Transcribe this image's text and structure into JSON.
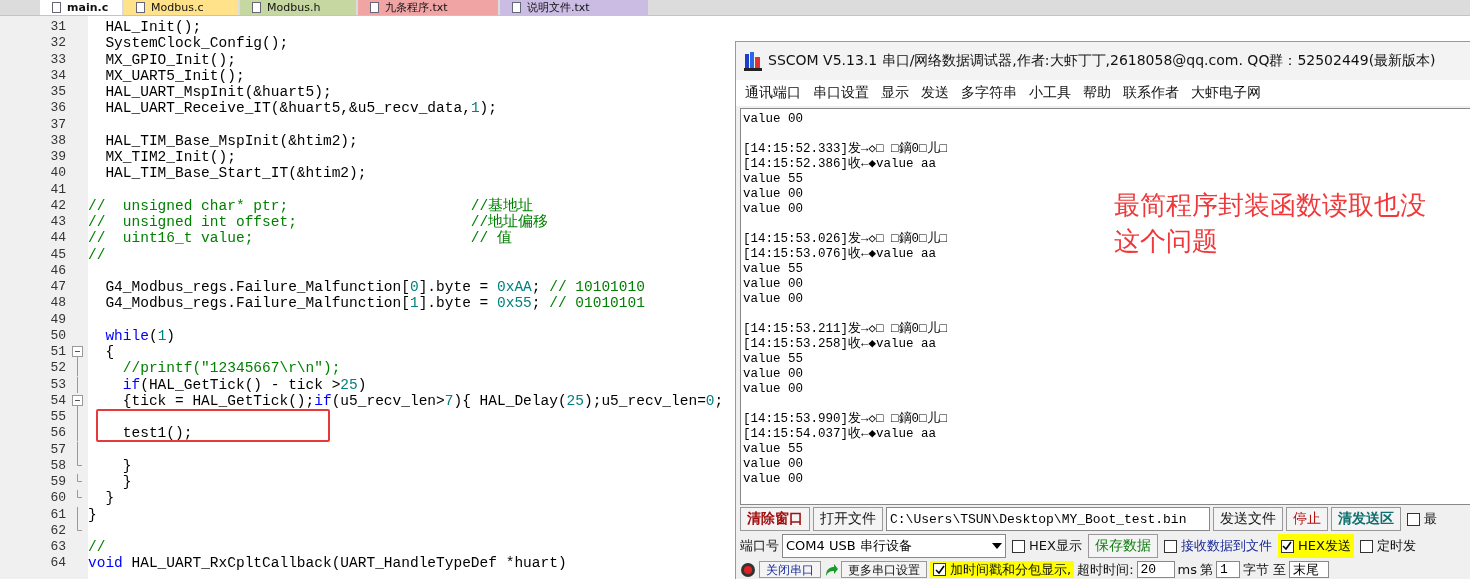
{
  "editor": {
    "tabs": [
      {
        "label": "main.c",
        "selected": true,
        "color": "#ffffff"
      },
      {
        "label": "Modbus.c",
        "selected": false,
        "color": "#ffe28a"
      },
      {
        "label": "Modbus.h",
        "selected": false,
        "color": "#c6d7a2"
      },
      {
        "label": "九条程序.txt",
        "selected": false,
        "color": "#f1a4a4"
      },
      {
        "label": "说明文件.txt",
        "selected": false,
        "color": "#cbbce3"
      }
    ],
    "lines": [
      {
        "number": "31",
        "segments": [
          {
            "kind": "plain",
            "text": "  HAL_Init();"
          }
        ]
      },
      {
        "number": "32",
        "segments": [
          {
            "kind": "plain",
            "text": "  SystemClock_Config();"
          }
        ]
      },
      {
        "number": "33",
        "segments": [
          {
            "kind": "plain",
            "text": "  MX_GPIO_Init();"
          }
        ]
      },
      {
        "number": "34",
        "segments": [
          {
            "kind": "plain",
            "text": "  MX_UART5_Init();"
          }
        ]
      },
      {
        "number": "35",
        "segments": [
          {
            "kind": "plain",
            "text": "  HAL_UART_MspInit(&huart5);"
          }
        ]
      },
      {
        "number": "36",
        "segments": [
          {
            "kind": "plain",
            "text": "  HAL_UART_Receive_IT(&huart5,&u5_recv_data,"
          },
          {
            "kind": "num",
            "text": "1"
          },
          {
            "kind": "plain",
            "text": ");"
          }
        ]
      },
      {
        "number": "37"
      },
      {
        "number": "38",
        "segments": [
          {
            "kind": "plain",
            "text": "  HAL_TIM_Base_MspInit(&htim2);"
          }
        ]
      },
      {
        "number": "39",
        "segments": [
          {
            "kind": "plain",
            "text": "  MX_TIM2_Init();"
          }
        ]
      },
      {
        "number": "40",
        "segments": [
          {
            "kind": "plain",
            "text": "  HAL_TIM_Base_Start_IT(&htim2);"
          }
        ]
      },
      {
        "number": "41"
      },
      {
        "number": "42",
        "segments": [
          {
            "kind": "cmt",
            "text": "//  unsigned char* ptr;                     //基地址"
          }
        ]
      },
      {
        "number": "43",
        "segments": [
          {
            "kind": "cmt",
            "text": "//  unsigned int offset;                    //地址偏移"
          }
        ]
      },
      {
        "number": "44",
        "segments": [
          {
            "kind": "cmt",
            "text": "//  uint16_t value;                         // 值"
          }
        ]
      },
      {
        "number": "45",
        "segments": [
          {
            "kind": "cmt",
            "text": "//"
          }
        ]
      },
      {
        "number": "46"
      },
      {
        "number": "47",
        "segments": [
          {
            "kind": "plain",
            "text": "  G4_Modbus_regs.Failure_Malfunction["
          },
          {
            "kind": "num",
            "text": "0"
          },
          {
            "kind": "plain",
            "text": "].byte = "
          },
          {
            "kind": "num",
            "text": "0xAA"
          },
          {
            "kind": "plain",
            "text": "; "
          },
          {
            "kind": "cmt",
            "text": "// 10101010"
          }
        ]
      },
      {
        "number": "48",
        "segments": [
          {
            "kind": "plain",
            "text": "  G4_Modbus_regs.Failure_Malfunction["
          },
          {
            "kind": "num",
            "text": "1"
          },
          {
            "kind": "plain",
            "text": "].byte = "
          },
          {
            "kind": "num",
            "text": "0x55"
          },
          {
            "kind": "plain",
            "text": "; "
          },
          {
            "kind": "cmt",
            "text": "// 01010101"
          }
        ]
      },
      {
        "number": "49"
      },
      {
        "number": "50",
        "segments": [
          {
            "kind": "kw",
            "text": "  while"
          },
          {
            "kind": "plain",
            "text": "("
          },
          {
            "kind": "num",
            "text": "1"
          },
          {
            "kind": "plain",
            "text": ")"
          }
        ]
      },
      {
        "number": "51",
        "kind": "fold_open",
        "segments": [
          {
            "kind": "plain",
            "text": "  {"
          }
        ]
      },
      {
        "number": "52",
        "kind": "fold_line",
        "segments": [
          {
            "kind": "cmt",
            "text": "    //printf(\"12345667\\r\\n\");"
          }
        ]
      },
      {
        "number": "53",
        "kind": "fold_line",
        "segments": [
          {
            "kind": "kw",
            "text": "    if"
          },
          {
            "kind": "plain",
            "text": "(HAL_GetTick() - tick >"
          },
          {
            "kind": "num",
            "text": "25"
          },
          {
            "kind": "plain",
            "text": ")"
          }
        ]
      },
      {
        "number": "54",
        "kind": "fold_open",
        "segments": [
          {
            "kind": "plain",
            "text": "    {tick = HAL_GetTick();"
          },
          {
            "kind": "kw",
            "text": "if"
          },
          {
            "kind": "plain",
            "text": "(u5_recv_len>"
          },
          {
            "kind": "num",
            "text": "7"
          },
          {
            "kind": "plain",
            "text": "){ HAL_Delay("
          },
          {
            "kind": "num",
            "text": "25"
          },
          {
            "kind": "plain",
            "text": ");u5_recv_len="
          },
          {
            "kind": "num",
            "text": "0"
          },
          {
            "kind": "plain",
            "text": ";"
          }
        ]
      },
      {
        "number": "55",
        "kind": "fold_line",
        "marked": true
      },
      {
        "number": "56",
        "kind": "fold_line",
        "marked": true,
        "segments": [
          {
            "kind": "plain",
            "text": "    test1();"
          }
        ]
      },
      {
        "number": "57",
        "kind": "fold_line"
      },
      {
        "number": "58",
        "kind": "fold_end",
        "segments": [
          {
            "kind": "plain",
            "text": "    }"
          }
        ]
      },
      {
        "number": "59",
        "kind": "fold_end",
        "segments": [
          {
            "kind": "plain",
            "text": "    }"
          }
        ]
      },
      {
        "number": "60",
        "kind": "fold_end",
        "segments": [
          {
            "kind": "plain",
            "text": "  }"
          }
        ]
      },
      {
        "number": "61",
        "kind": "fold_line",
        "segments": [
          {
            "kind": "plain",
            "text": "}"
          }
        ]
      },
      {
        "number": "62",
        "kind": "fold_end"
      },
      {
        "number": "63",
        "segments": [
          {
            "kind": "cmt",
            "text": "//"
          }
        ]
      },
      {
        "number": "64",
        "segments": [
          {
            "kind": "kw",
            "text": "void"
          },
          {
            "kind": "plain",
            "text": " HAL_UART_RxCpltCallback(UART_HandleTypeDef *huart)"
          }
        ]
      }
    ]
  },
  "sscom": {
    "title": "SSCOM V5.13.1 串口/网络数据调试器,作者:大虾丁丁,2618058@qq.com. QQ群：52502449(最新版本)",
    "menu": [
      "通讯端口",
      "串口设置",
      "显示",
      "发送",
      "多字符串",
      "小工具",
      "帮助",
      "联系作者",
      "大虾电子网"
    ],
    "log": [
      [
        "value 00"
      ],
      [
        "[14:15:52.333]发→◇□ □鏑0□儿□",
        "[14:15:52.386]收←◆value aa",
        "value 55",
        "value 00",
        "value 00"
      ],
      [
        "[14:15:53.026]发→◇□ □鏑0□儿□",
        "[14:15:53.076]收←◆value aa",
        "value 55",
        "value 00",
        "value 00"
      ],
      [
        "[14:15:53.211]发→◇□ □鏑0□儿□",
        "[14:15:53.258]收←◆value aa",
        "value 55",
        "value 00",
        "value 00"
      ],
      [
        "[14:15:53.990]发→◇□ □鏑0□儿□",
        "[14:15:54.037]收←◆value aa",
        "value 55",
        "value 00",
        "value 00"
      ]
    ],
    "note": [
      "最简程序封装函数读取也没",
      "这个问题"
    ],
    "row1": {
      "clear": "清除窗口",
      "open_file": "打开文件",
      "path": "C:\\Users\\TSUN\\Desktop\\MY_Boot_test.bin",
      "send_file": "发送文件",
      "stop": "停止",
      "clear_send": "清发送区",
      "top": {
        "label": "最",
        "checked": false
      }
    },
    "row2": {
      "port_label": "端口号",
      "port": "COM4 USB 串行设备",
      "hex_display": {
        "label": "HEX显示",
        "checked": false
      },
      "save": "保存数据",
      "to_file": {
        "label": "接收数据到文件",
        "checked": false
      },
      "hex_send": {
        "label": "HEX发送",
        "checked": true
      },
      "timed": {
        "label": "定时发",
        "checked": false
      }
    },
    "row3": {
      "close_port": "关闭串口",
      "more": "更多串口设置",
      "timestamp": {
        "label": "加时间戳和分包显示,",
        "checked": true
      },
      "timeout_label": "超时时间:",
      "timeout": "20",
      "ms": "ms",
      "nth": "第",
      "byte_from": "1",
      "byte_to": "字节 至",
      "end": "末尾"
    }
  }
}
